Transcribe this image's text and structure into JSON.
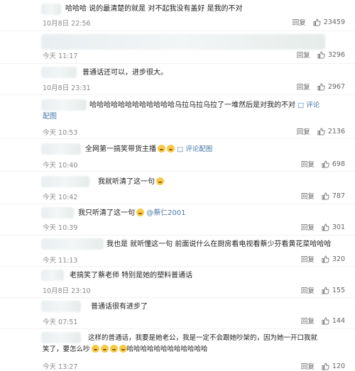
{
  "comments": [
    {
      "text": "哈哈哈  说的最清楚的就是 对不起我没有盖好 是我的不对",
      "time": "10月8日 22:56",
      "reply": "回复",
      "likes": "23459"
    },
    {
      "text": "",
      "time": "今天 11:17",
      "reply": "回复",
      "likes": "3296"
    },
    {
      "text": "普通话还可以，进步很大。",
      "time": "10月8日 23:31",
      "reply": "回复",
      "likes": "2967"
    },
    {
      "text": "哈哈哈哈哈哈哈哈哈哈哈哈乌拉乌拉乌拉了一堆然后是对我的不对",
      "text2": "配图",
      "link": "评论",
      "time": "今天 10:53",
      "reply": "回复",
      "likes": "2136"
    },
    {
      "text": "全网第一搞笑带货主播",
      "link": "评论配图",
      "time": "今天 10:40",
      "reply": "回复",
      "likes": "698"
    },
    {
      "text": "我就听清了这一句",
      "time": "今天 10:42",
      "reply": "回复",
      "likes": "787"
    },
    {
      "text": "我只听清了这一句",
      "mention": "@蔡仁2001",
      "time": "今天 10:39",
      "reply": "回复",
      "likes": "301"
    },
    {
      "text": "我也是 就听懂这一句 前面说什么在厨房看电视看蔡少芬看黄花菜哈哈哈",
      "time": "今天 11:13",
      "reply": "回复",
      "likes": "320"
    },
    {
      "text": "老搞笑了蔡老师 特别是她的塑料普通话",
      "time": "10月8日 23:10",
      "reply": "回复",
      "likes": "155"
    },
    {
      "text": "普通话很有进步了",
      "time": "今天 07:51",
      "reply": "回复",
      "likes": "144"
    },
    {
      "text": "这样的普通话，我要是她老公，我是一定不会跟她吵架的，因为她一开口我就",
      "text2": "笑了，要怎么吵",
      "text3": "哈哈哈哈哈哈哈哈哈哈哈哈",
      "time": "今天 13:27",
      "reply": "回复",
      "likes": "120"
    }
  ]
}
